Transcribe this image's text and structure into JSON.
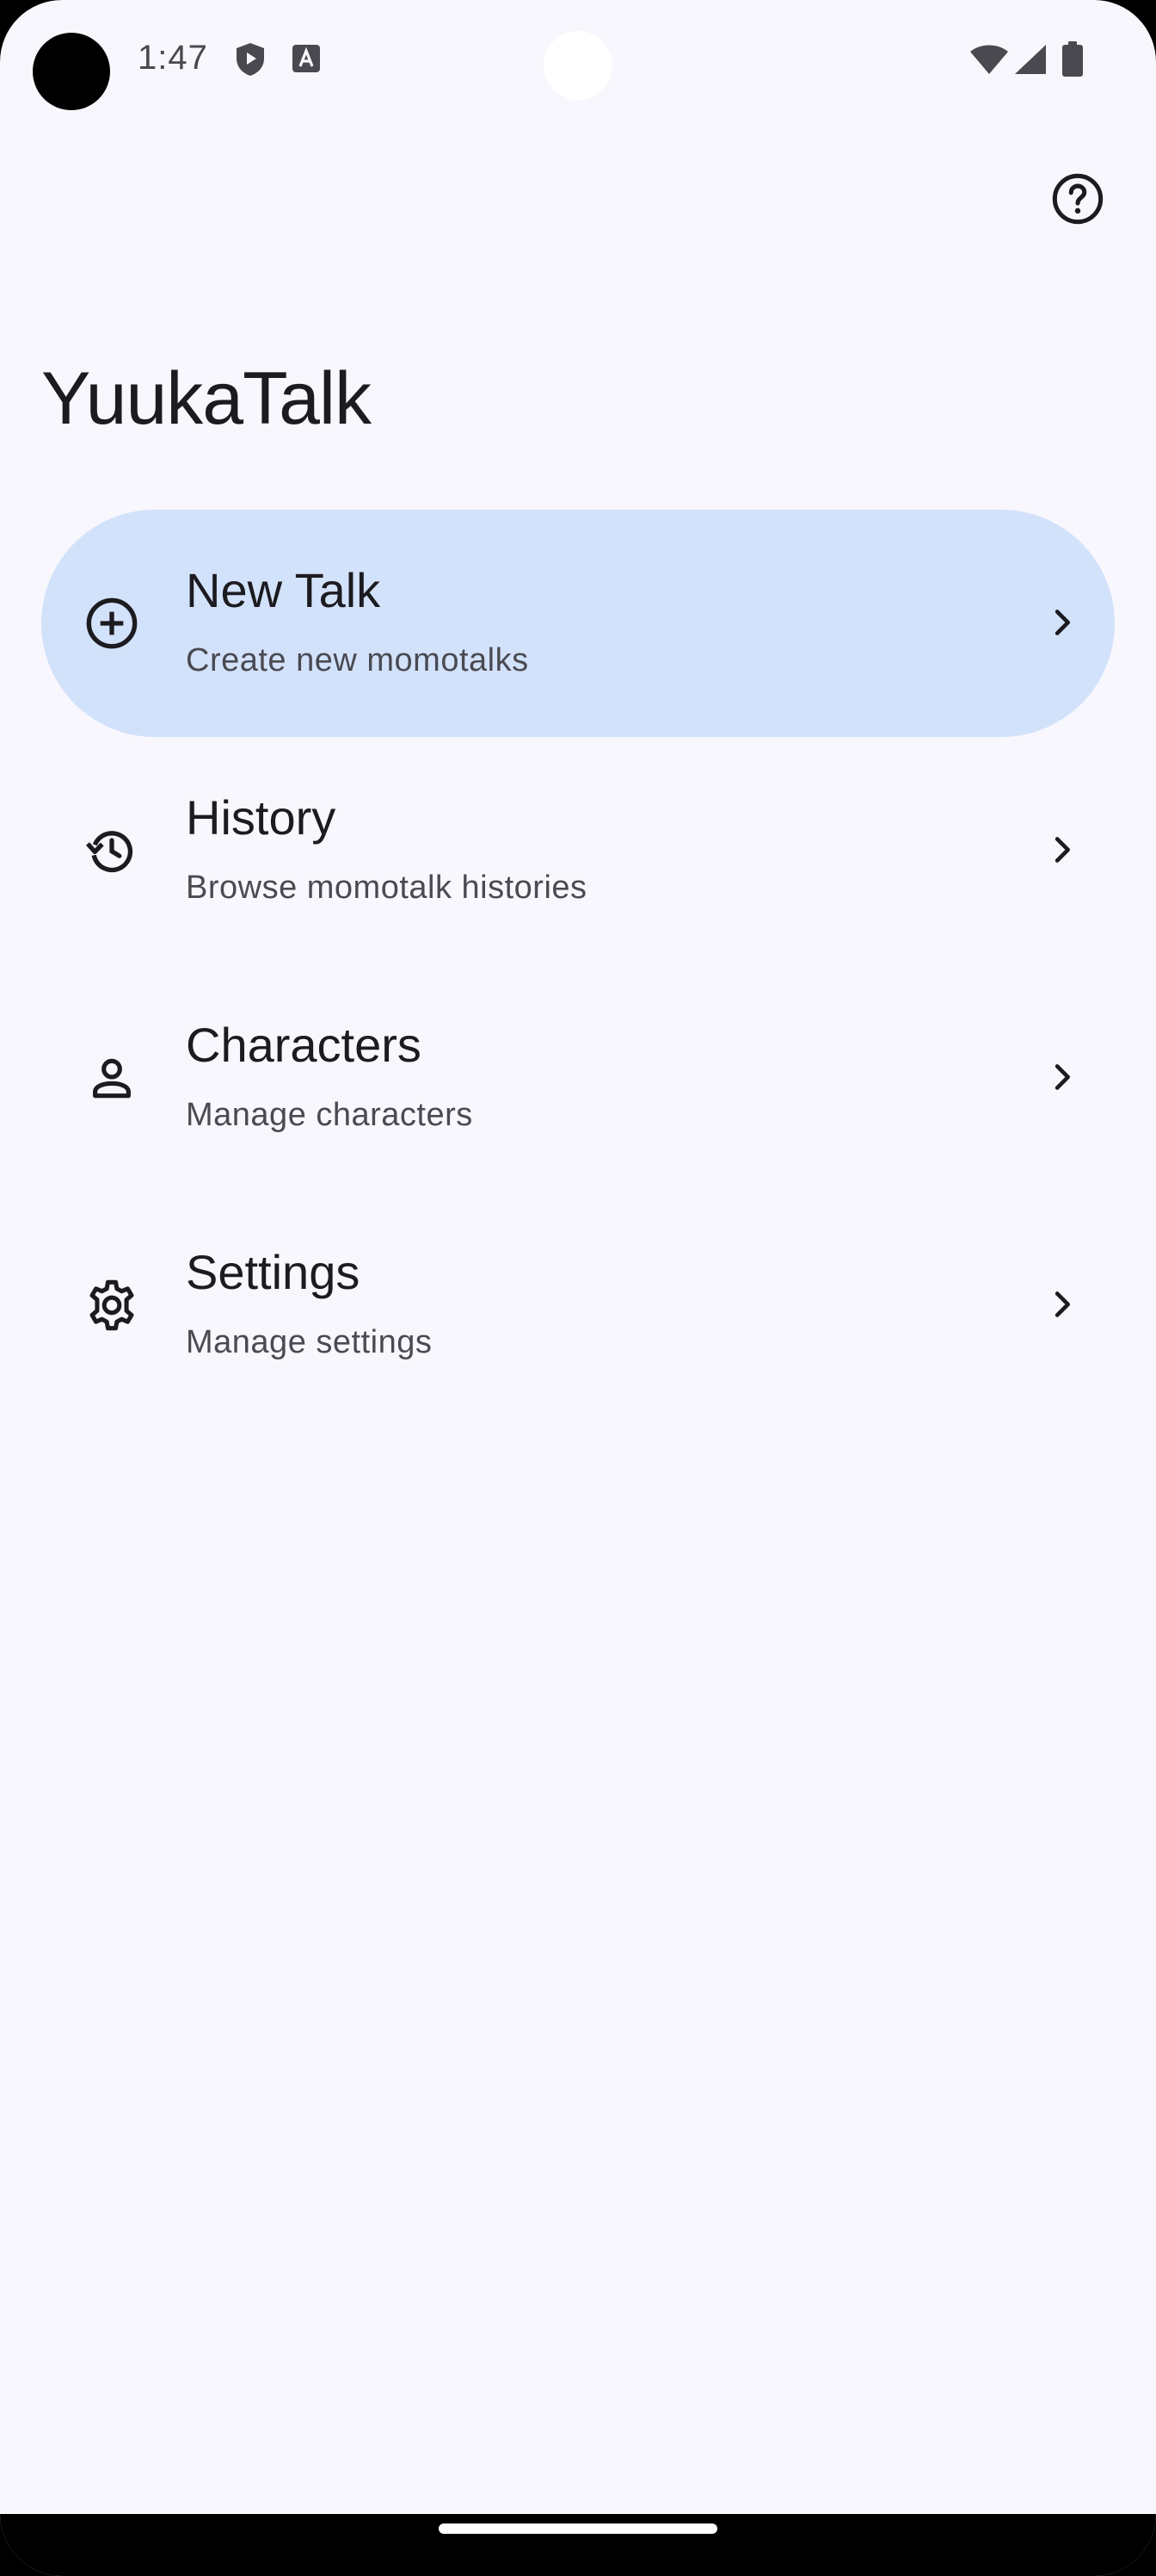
{
  "status_bar": {
    "time": "1:47",
    "icons": [
      "play-protect-icon",
      "keyboard-a-icon",
      "wifi-icon",
      "cellular-signal-icon",
      "battery-icon"
    ]
  },
  "header": {
    "help_icon": "help-circle-icon"
  },
  "app_title": "YuukaTalk",
  "menu": {
    "items": [
      {
        "title": "New Talk",
        "subtitle": "Create new momotalks",
        "icon": "add-circle-icon",
        "selected": true
      },
      {
        "title": "History",
        "subtitle": "Browse momotalk histories",
        "icon": "history-icon",
        "selected": false
      },
      {
        "title": "Characters",
        "subtitle": "Manage characters",
        "icon": "person-icon",
        "selected": false
      },
      {
        "title": "Settings",
        "subtitle": "Manage settings",
        "icon": "gear-icon",
        "selected": false
      }
    ]
  },
  "colors": {
    "background": "#f8f7fd",
    "selected_item": "#d3e2fb",
    "text_primary": "#1c1b20",
    "text_secondary": "#4a4a52"
  }
}
